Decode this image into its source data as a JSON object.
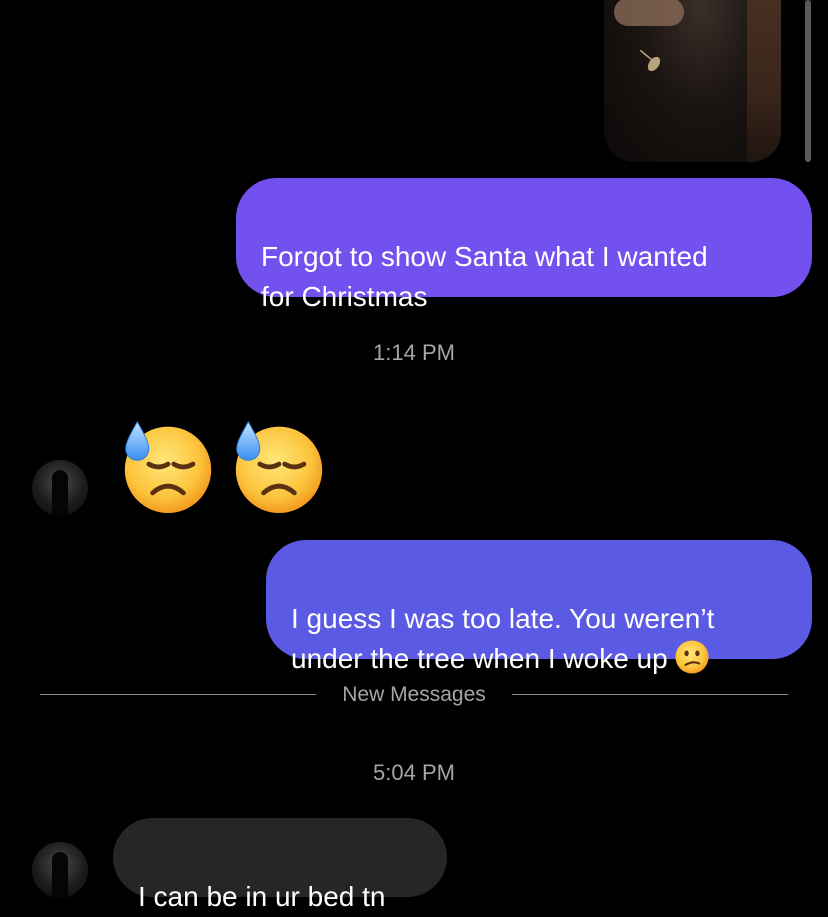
{
  "messages": {
    "outgoing_1": "Forgot to show Santa what I wanted\nfor Christmas",
    "timestamp_1": "1:14 PM",
    "reaction_emoji": [
      "downcast-face-with-sweat",
      "downcast-face-with-sweat"
    ],
    "outgoing_2": "I guess I was too late. You weren’t\nunder the tree when I woke up",
    "outgoing_2_emoji": "confused-face",
    "new_messages_label": "New Messages",
    "timestamp_2": "5:04 PM",
    "incoming_1": "I can be in ur bed tn"
  },
  "colors": {
    "background": "#000000",
    "outgoing_bubble_1": "#7351ee",
    "outgoing_bubble_2": "#5b5ae4",
    "incoming_bubble": "#262626",
    "secondary_text": "#a5a5a5"
  }
}
